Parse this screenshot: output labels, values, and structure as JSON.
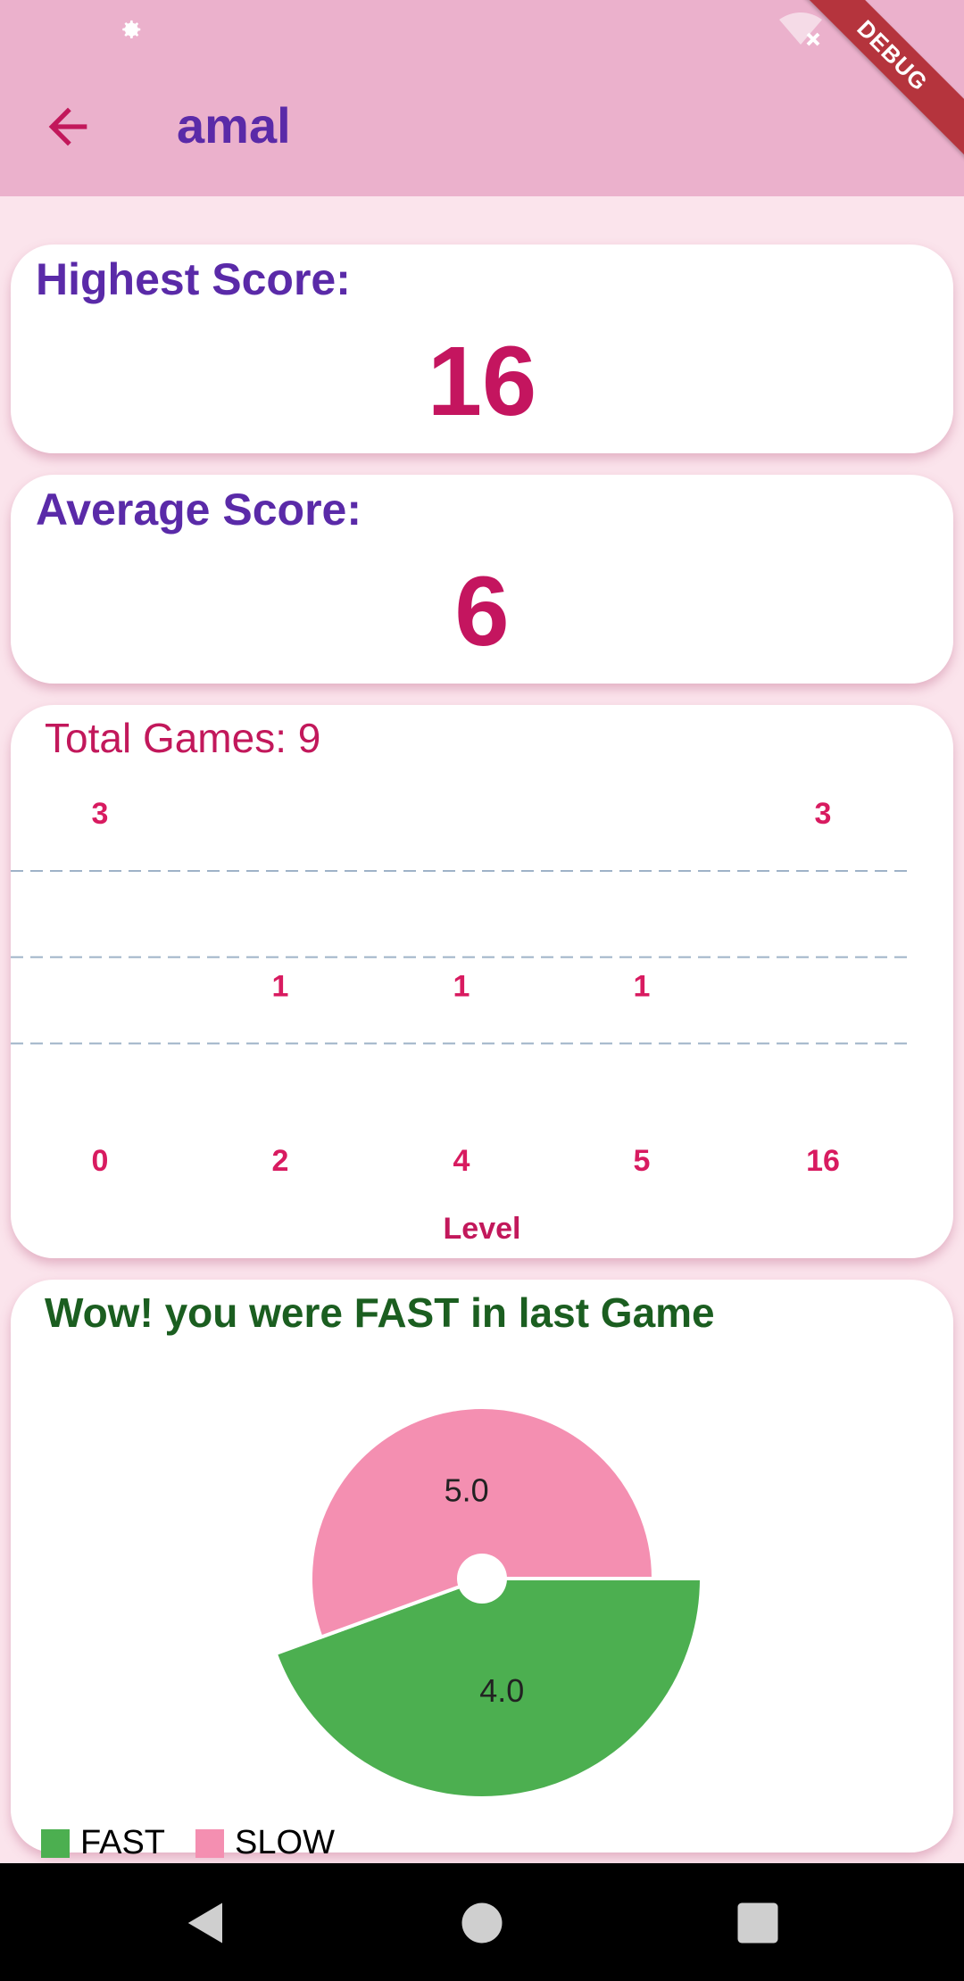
{
  "app_bar": {
    "title": "amal"
  },
  "debug_banner": "DEBUG",
  "highest_card": {
    "title": "Highest Score:",
    "value": "16"
  },
  "average_card": {
    "title": "Average Score:",
    "value": "6"
  },
  "games_card": {
    "title": "Total Games: 9"
  },
  "speed_card": {
    "title": "Wow! you were FAST in last Game"
  },
  "chart_data": [
    {
      "type": "bar",
      "categories": [
        "0",
        "2",
        "4",
        "5",
        "16"
      ],
      "values": [
        3,
        1,
        1,
        1,
        3
      ],
      "xlabel": "Level",
      "ylabel": "",
      "ylim": [
        0,
        3
      ],
      "grid": true,
      "colors": {
        "bar_top": "#8b4fc7",
        "bar_bottom": "#ff7043",
        "label": "#d81b60",
        "grid": "#9fb3c8"
      }
    },
    {
      "type": "pie",
      "labels": [
        "FAST",
        "SLOW"
      ],
      "values": [
        4.0,
        5.0
      ],
      "value_labels": [
        "4.0",
        "5.0"
      ],
      "colors": [
        "#4caf50",
        "#f48fb1"
      ],
      "legend": "bottom-left"
    }
  ],
  "icons": {
    "status": [
      "gear-icon",
      "wifi-off-icon"
    ],
    "appbar": "back-arrow-icon",
    "navbar": [
      "back-triangle-icon",
      "home-circle-icon",
      "recents-square-icon"
    ]
  },
  "colors": {
    "accent": "#c4155f",
    "title": "#5a2aa8",
    "appbar": "#ebb1cc",
    "background": "#fbe4ec"
  }
}
